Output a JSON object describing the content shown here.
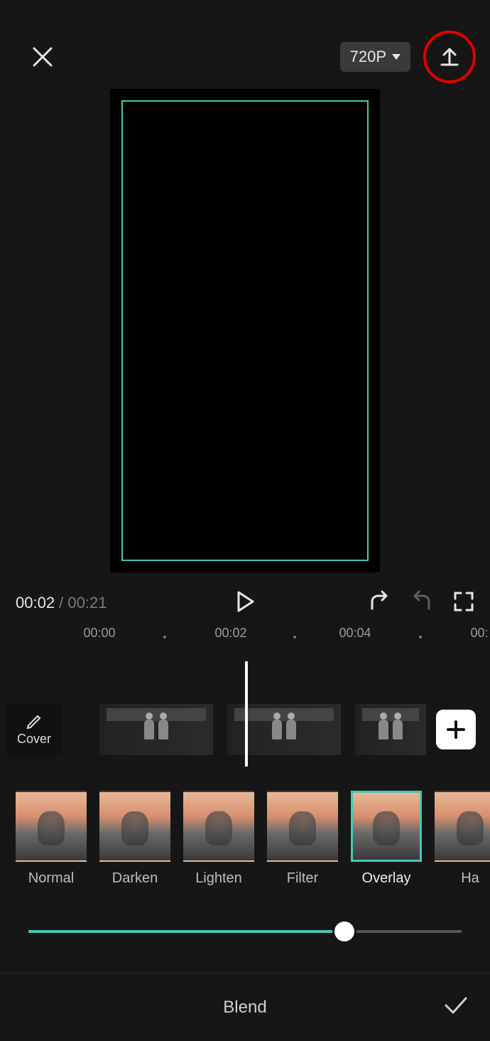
{
  "header": {
    "resolution_label": "720P"
  },
  "playback": {
    "current_time": "00:02",
    "separator": " / ",
    "duration": "00:21"
  },
  "ruler": {
    "marks": [
      "00:00",
      "00:02",
      "00:04",
      "00:"
    ]
  },
  "timeline": {
    "cover_label": "Cover"
  },
  "blend_modes": {
    "items": [
      {
        "label": "Normal",
        "selected": false
      },
      {
        "label": "Darken",
        "selected": false
      },
      {
        "label": "Lighten",
        "selected": false
      },
      {
        "label": "Filter",
        "selected": false
      },
      {
        "label": "Overlay",
        "selected": true
      },
      {
        "label": "Ha",
        "selected": false
      }
    ]
  },
  "slider": {
    "value_percent": 73
  },
  "footer": {
    "panel_title": "Blend"
  }
}
